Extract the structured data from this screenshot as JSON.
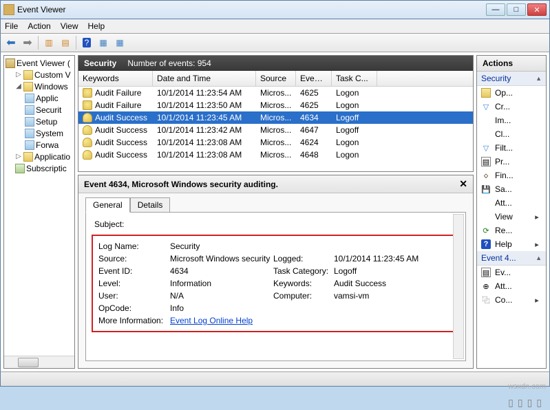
{
  "window": {
    "title": "Event Viewer"
  },
  "menu": {
    "file": "File",
    "action": "Action",
    "view": "View",
    "help": "Help"
  },
  "tree": {
    "root": "Event Viewer (",
    "custom": "Custom V",
    "windows": "Windows",
    "app": "Applic",
    "security": "Securit",
    "setup": "Setup",
    "system": "System",
    "forw": "Forwa",
    "applications": "Applicatio",
    "subs": "Subscriptic"
  },
  "list": {
    "header_title": "Security",
    "header_count": "Number of events: 954",
    "cols": {
      "kw": "Keywords",
      "dt": "Date and Time",
      "src": "Source",
      "id": "Event ID",
      "tc": "Task C..."
    },
    "rows": [
      {
        "kw": "Audit Failure",
        "dt": "10/1/2014 11:23:54 AM",
        "src": "Micros...",
        "id": "4625",
        "tc": "Logon",
        "icon": "lock"
      },
      {
        "kw": "Audit Failure",
        "dt": "10/1/2014 11:23:50 AM",
        "src": "Micros...",
        "id": "4625",
        "tc": "Logon",
        "icon": "lock"
      },
      {
        "kw": "Audit Success",
        "dt": "10/1/2014 11:23:45 AM",
        "src": "Micros...",
        "id": "4634",
        "tc": "Logoff",
        "icon": "key",
        "sel": true
      },
      {
        "kw": "Audit Success",
        "dt": "10/1/2014 11:23:42 AM",
        "src": "Micros...",
        "id": "4647",
        "tc": "Logoff",
        "icon": "key"
      },
      {
        "kw": "Audit Success",
        "dt": "10/1/2014 11:23:08 AM",
        "src": "Micros...",
        "id": "4624",
        "tc": "Logon",
        "icon": "key"
      },
      {
        "kw": "Audit Success",
        "dt": "10/1/2014 11:23:08 AM",
        "src": "Micros...",
        "id": "4648",
        "tc": "Logon",
        "icon": "key"
      }
    ]
  },
  "detail": {
    "title": "Event 4634, Microsoft Windows security auditing.",
    "tabs": {
      "general": "General",
      "details": "Details"
    },
    "subject": "Subject:",
    "props": {
      "log_name_k": "Log Name:",
      "log_name_v": "Security",
      "source_k": "Source:",
      "source_v": "Microsoft Windows security",
      "logged_k": "Logged:",
      "logged_v": "10/1/2014 11:23:45 AM",
      "eventid_k": "Event ID:",
      "eventid_v": "4634",
      "taskcat_k": "Task Category:",
      "taskcat_v": "Logoff",
      "level_k": "Level:",
      "level_v": "Information",
      "keywords_k": "Keywords:",
      "keywords_v": "Audit Success",
      "user_k": "User:",
      "user_v": "N/A",
      "computer_k": "Computer:",
      "computer_v": "vamsi-vm",
      "opcode_k": "OpCode:",
      "opcode_v": "Info",
      "more_k": "More Information:",
      "more_v": "Event Log Online Help"
    }
  },
  "actions": {
    "header": "Actions",
    "group1": "Security",
    "open": "Op...",
    "create": "Cr...",
    "import": "Im...",
    "clear": "Cl...",
    "filter": "Filt...",
    "props": "Pr...",
    "find": "Fin...",
    "save": "Sa...",
    "attach": "Att...",
    "view": "View",
    "refresh": "Re...",
    "help": "Help",
    "group2": "Event 4...",
    "evprops": "Ev...",
    "att2": "Att...",
    "copy": "Co..."
  },
  "watermark": "wsxdn.com"
}
